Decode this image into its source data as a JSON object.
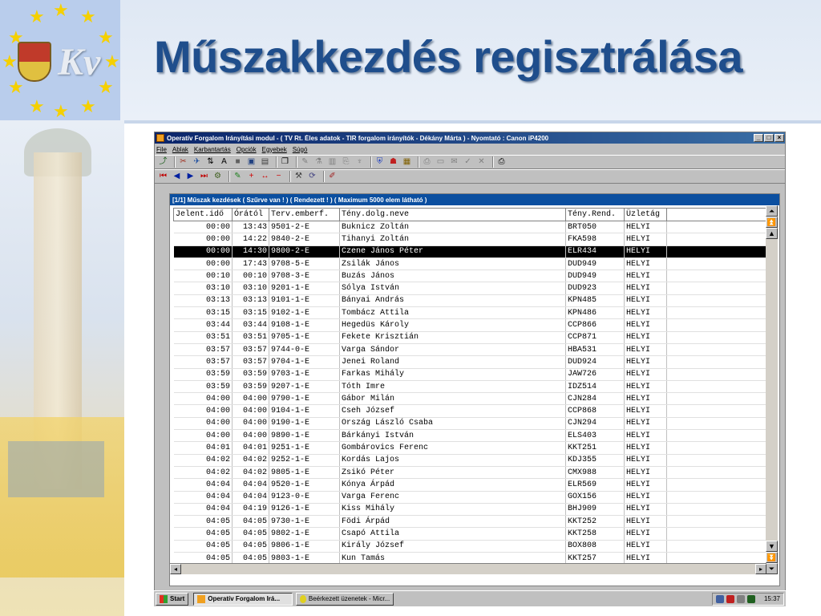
{
  "slide": {
    "title": "Műszakkezdés regisztrálása",
    "logo_text": "Kv"
  },
  "window": {
    "title": "Operatív Forgalom Irányítási modul - ( TV Rt. Éles adatok - TIR forgalom irányítók - Dékány Márta ) - Nyomtató : Canon iP4200",
    "buttons": [
      "_",
      "□",
      "×"
    ]
  },
  "menu": {
    "items": [
      "File",
      "Ablak",
      "Karbantartás",
      "Opciók",
      "Egyebek",
      "Súgó"
    ]
  },
  "toolbar": {
    "row1_icons": [
      "exit-icon",
      "tools-icon",
      "plane-icon",
      "sort-icon",
      "font-icon",
      "stop-icon",
      "save-icon",
      "disk-icon",
      "window-icon",
      "brush-icon",
      "flask-icon",
      "grid-icon",
      "clip-icon",
      "tool-icon",
      "shield-icon",
      "user-icon",
      "card-icon",
      "print-icon",
      "folder-icon",
      "mail-icon",
      "check-icon",
      "cross-icon",
      "printer-icon"
    ],
    "row2_icons": [
      "first-icon",
      "prev-icon",
      "next-icon",
      "last-icon",
      "filter-icon",
      "edit-icon",
      "plus-icon",
      "arrows-icon",
      "minus-icon",
      "wrench-icon",
      "refresh-icon",
      "abc-icon"
    ]
  },
  "grid": {
    "caption": "[1/1] Műszak kezdések ( Szűrve van ! ) ( Rendezett ! ) ( Maximum 5000 elem látható )",
    "columns": [
      "Jelent.idő",
      "Órától",
      "Terv.emberf.",
      "Tény.dolg.neve",
      "Tény.Rend.",
      "Üzletág",
      ""
    ],
    "selected_row": 2,
    "rows": [
      [
        "00:00",
        "13:43",
        "9501-2-E",
        "Buknicz Zoltán",
        "BRT050",
        "HELYI"
      ],
      [
        "00:00",
        "14:22",
        "9840-2-E",
        "Tihanyi Zoltán",
        "FKA598",
        "HELYI"
      ],
      [
        "00:00",
        "14:30",
        "9800-2-E",
        "Czene János Péter",
        "ELR434",
        "HELYI"
      ],
      [
        "00:00",
        "17:43",
        "9708-5-E",
        "Zsilák János",
        "DUD949",
        "HELYI"
      ],
      [
        "00:10",
        "00:10",
        "9708-3-E",
        "Buzás János",
        "DUD949",
        "HELYI"
      ],
      [
        "03:10",
        "03:10",
        "9201-1-E",
        "Sólya István",
        "DUD923",
        "HELYI"
      ],
      [
        "03:13",
        "03:13",
        "9101-1-E",
        "Bányai András",
        "KPN485",
        "HELYI"
      ],
      [
        "03:15",
        "03:15",
        "9102-1-E",
        "Tombácz Attila",
        "KPN486",
        "HELYI"
      ],
      [
        "03:44",
        "03:44",
        "9108-1-E",
        "Hegedüs Károly",
        "CCP866",
        "HELYI"
      ],
      [
        "03:51",
        "03:51",
        "9705-1-E",
        "Fekete Krisztián",
        "CCP871",
        "HELYI"
      ],
      [
        "03:57",
        "03:57",
        "9744-0-E",
        "Varga Sándor",
        "HBA531",
        "HELYI"
      ],
      [
        "03:57",
        "03:57",
        "9704-1-E",
        "Jenei Roland",
        "DUD924",
        "HELYI"
      ],
      [
        "03:59",
        "03:59",
        "9703-1-E",
        "Farkas Mihály",
        "JAW726",
        "HELYI"
      ],
      [
        "03:59",
        "03:59",
        "9207-1-E",
        "Tóth Imre",
        "IDZ514",
        "HELYI"
      ],
      [
        "04:00",
        "04:00",
        "9790-1-E",
        "Gábor Milán",
        "CJN284",
        "HELYI"
      ],
      [
        "04:00",
        "04:00",
        "9104-1-E",
        "Cseh József",
        "CCP868",
        "HELYI"
      ],
      [
        "04:00",
        "04:00",
        "9190-1-E",
        "Ország László Csaba",
        "CJN294",
        "HELYI"
      ],
      [
        "04:00",
        "04:00",
        "9890-1-E",
        "Bárkányi István",
        "ELS403",
        "HELYI"
      ],
      [
        "04:01",
        "04:01",
        "9251-1-E",
        "Gombárovics Ferenc",
        "KKT251",
        "HELYI"
      ],
      [
        "04:02",
        "04:02",
        "9252-1-E",
        "Kordás Lajos",
        "KDJ355",
        "HELYI"
      ],
      [
        "04:02",
        "04:02",
        "9805-1-E",
        "Zsikó Péter",
        "CMX988",
        "HELYI"
      ],
      [
        "04:04",
        "04:04",
        "9520-1-E",
        "Kónya Árpád",
        "ELR569",
        "HELYI"
      ],
      [
        "04:04",
        "04:04",
        "9123-0-E",
        "Varga Ferenc",
        "GOX156",
        "HELYI"
      ],
      [
        "04:04",
        "04:19",
        "9126-1-E",
        "Kiss Mihály",
        "BHJ909",
        "HELYI"
      ],
      [
        "04:05",
        "04:05",
        "9730-1-E",
        "Födi Árpád",
        "KKT252",
        "HELYI"
      ],
      [
        "04:05",
        "04:05",
        "9802-1-E",
        "Csapó Attila",
        "KKT258",
        "HELYI"
      ],
      [
        "04:05",
        "04:05",
        "9806-1-E",
        "Király József",
        "BOX808",
        "HELYI"
      ],
      [
        "04:05",
        "04:05",
        "9803-1-E",
        "Kun Tamás",
        "KKT257",
        "HELYI"
      ]
    ]
  },
  "taskbar": {
    "start_label": "Start",
    "tasks": [
      "Operatív Forgalom Irá...",
      "Beérkezett üzenetek - Micr..."
    ],
    "clock": "15:37"
  }
}
